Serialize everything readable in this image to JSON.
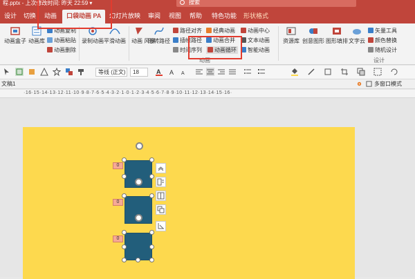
{
  "titlebar": {
    "file_text": "程.pptx - 上次修改时间: 昨天 22:59 ▾",
    "search_label": "搜索"
  },
  "tabs": [
    {
      "label": "设计",
      "active": false
    },
    {
      "label": "切换",
      "active": false
    },
    {
      "label": "动画",
      "active": false
    },
    {
      "label": "口袋动画 PA",
      "active": true
    },
    {
      "label": "幻灯片放映",
      "active": false
    },
    {
      "label": "审阅",
      "active": false
    },
    {
      "label": "视图",
      "active": false
    },
    {
      "label": "帮助",
      "active": false
    },
    {
      "label": "特色功能",
      "active": false
    },
    {
      "label": "形状格式",
      "active": false
    }
  ],
  "ribbon": {
    "anim_box": "动画盒子",
    "anim_lib": "动画库",
    "copy_anim": "动画复制",
    "paste_anim": "动画粘贴",
    "delete_anim": "动画删除",
    "record_anim": "录制动画",
    "smooth_anim": "平滑动画",
    "anim_style": "动画\n风暴",
    "shape_path": "形转路径",
    "path_align": "路径对齐",
    "insert_path": "插帧路径",
    "time_seq": "时间序列",
    "classic_anim": "经典动画",
    "anim_merge": "动画合并",
    "anim_loop": "动画循环",
    "anim_center": "动画中心",
    "text_anim": "文本动画",
    "smart_anim": "智能动画",
    "group_anim": "动画",
    "resource_lib": "资源库",
    "creative_shape": "创意图形",
    "shape_fill": "图形填排",
    "text_cloud": "文字云",
    "vector_tool": "矢量工具",
    "color_replace": "颜色替换",
    "random_design": "随机设计",
    "group_design": "设计"
  },
  "format_bar": {
    "font_name": "等线 (正文)",
    "font_size": "18"
  },
  "doc_tab": "文稿1",
  "multi_window": "多窗口模式",
  "ruler_text": "·16·15·14·13·12·11·10·9·8·7·6·5·4·3·2·1·0·1·2·3·4·5·6·7·8·9·10·11·12·13·14·15·16·",
  "slide": {
    "squares": [
      {
        "tag": "0"
      },
      {
        "tag": "0"
      },
      {
        "tag": "0"
      }
    ]
  },
  "colors": {
    "accent": "#c0453b",
    "slide_bg": "#fdd94e",
    "square": "#225e7b",
    "highlight": "#e23b2e"
  }
}
